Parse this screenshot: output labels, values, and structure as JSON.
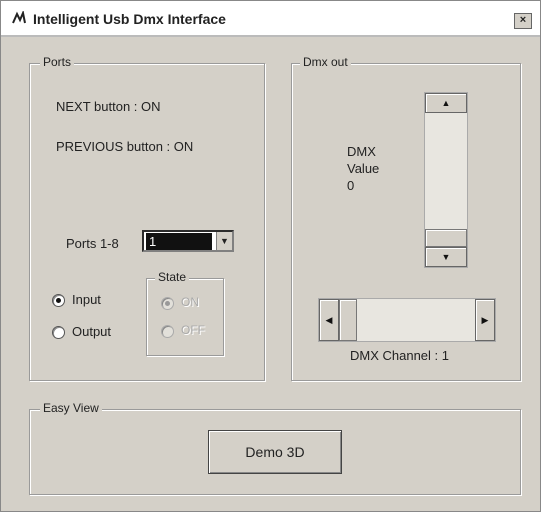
{
  "window": {
    "title": "Intelligent Usb Dmx Interface",
    "close_glyph": "×"
  },
  "ports": {
    "legend": "Ports",
    "next_status": "NEXT button :  ON",
    "prev_status": "PREVIOUS button :  ON",
    "ports_label": "Ports 1-8",
    "ports_value": "1",
    "input_label": "Input",
    "output_label": "Output",
    "mode_selected": "Input",
    "state": {
      "legend": "State",
      "on_label": "ON",
      "off_label": "OFF",
      "selected": "ON",
      "enabled": false
    }
  },
  "dmx_out": {
    "legend": "Dmx out",
    "value_line1": "DMX",
    "value_line2": "Value",
    "value": "0",
    "channel_label": "DMX Channel : 1",
    "value_level": 0,
    "channel_level": 0
  },
  "easy_view": {
    "legend": "Easy View",
    "demo_button": "Demo 3D"
  }
}
